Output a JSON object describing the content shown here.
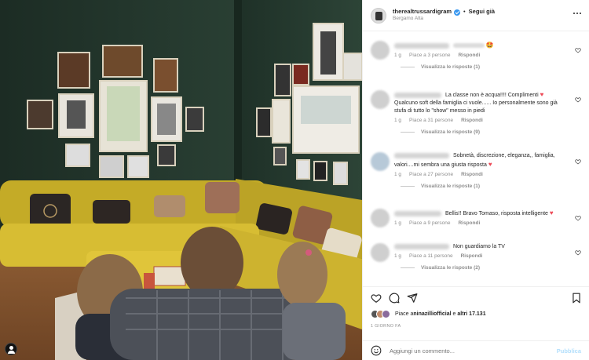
{
  "post": {
    "username": "therealtrussardigram",
    "follow_label": "Segui già",
    "location": "Bergamo Alta"
  },
  "comments": [
    {
      "text": "",
      "emoji": "🤩",
      "time": "1 g",
      "likes": "Piace a 3 persone",
      "reply_label": "Rispondi",
      "replies": "Visualizza le risposte (1)"
    },
    {
      "text": "La classe non è acqua!!!! Complimenti",
      "text2": "Qualcuno soft della famiglia ci vuole...... Io personalmente sono già stufa di tutto lo \"show\" messo in piedi",
      "time": "1 g",
      "likes": "Piace a 31 persone",
      "reply_label": "Rispondi",
      "replies": "Visualizza le risposte (9)"
    },
    {
      "text": "Sobnetà, discrezione, eleganza,, famiglia, valori....mi sembra una giusta risposta",
      "time": "1 g",
      "likes": "Piace a 27 persone",
      "reply_label": "Rispondi",
      "replies": "Visualizza le risposte (1)"
    },
    {
      "text": "Bellis!! Bravo Tomaso, risposta intelligente",
      "time": "1 g",
      "likes": "Piace a 9 persone",
      "reply_label": "Rispondi"
    },
    {
      "text": "Non guardiamo la TV",
      "time": "1 g",
      "likes": "Piace a 11 persone",
      "reply_label": "Rispondi",
      "replies": "Visualizza le risposte (2)"
    }
  ],
  "likes": {
    "prefix": "Piace a ",
    "user": "ninazilliofficial",
    "middle": " e ",
    "others": "altri 17.131"
  },
  "date": "1 GIORNO FA",
  "add_comment": {
    "placeholder": "Aggiungi un commento...",
    "publish": "Pubblica"
  },
  "colors": {
    "wall": "#23362c",
    "sofa": "#c9b12a",
    "accent": "#ed4956",
    "verified": "#3897f0"
  }
}
